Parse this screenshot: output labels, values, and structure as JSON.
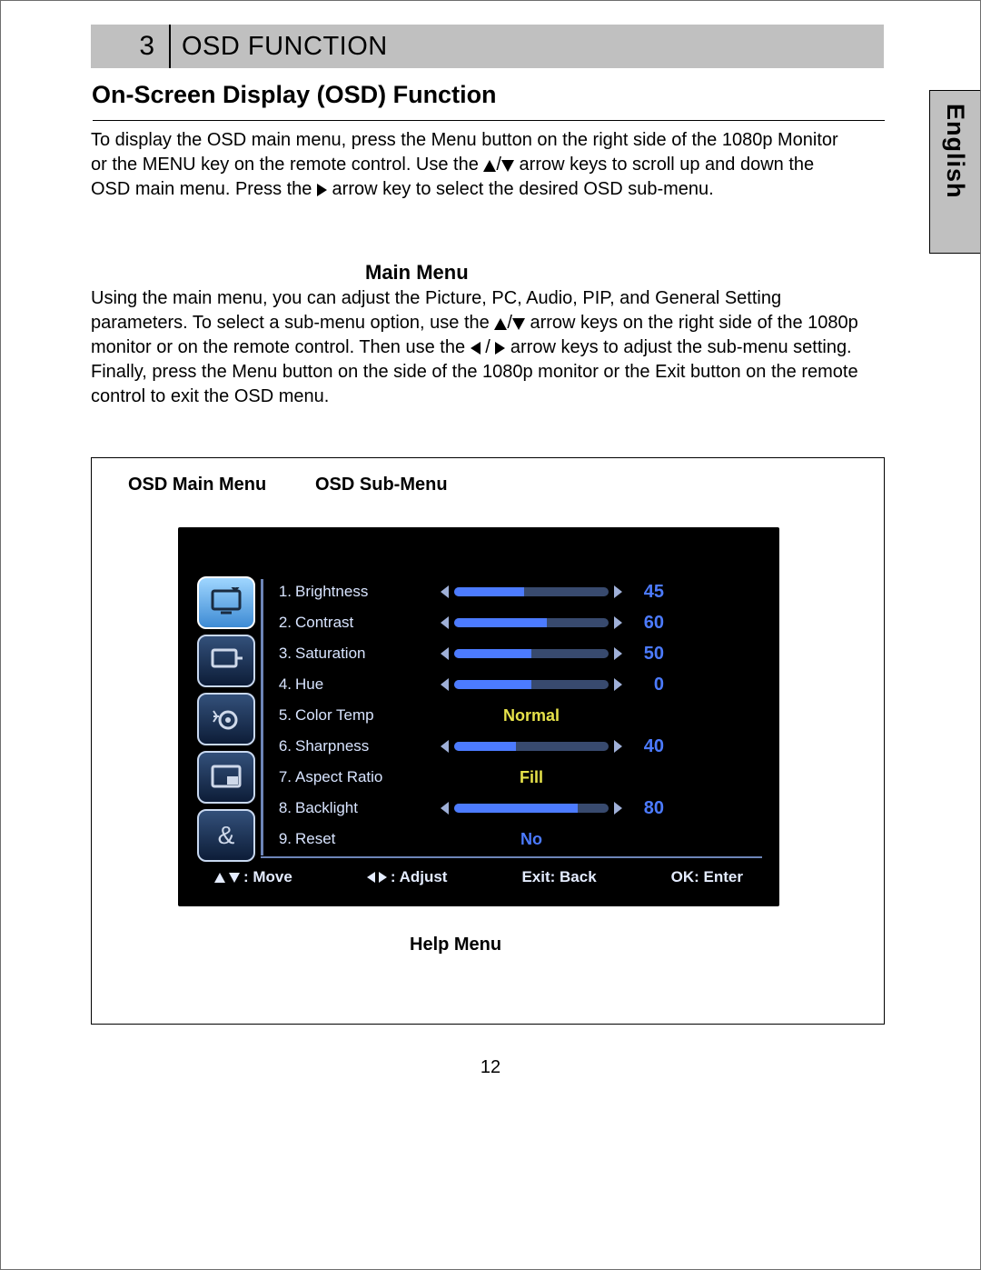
{
  "chapter": {
    "number": "3",
    "title": "OSD FUNCTION"
  },
  "language_tab": "English",
  "section_heading": "On-Screen Display (OSD) Function",
  "intro": {
    "p1": "To display the OSD main menu, press the Menu button on the right side of the 1080p Monitor or the MENU key on the remote control. Use the ",
    "p2": " arrow keys to scroll up and down the OSD main menu.    Press the ",
    "p3": " arrow key to select the desired OSD sub-menu."
  },
  "mainmenu": {
    "title": "Main Menu",
    "p1": "Using the main menu, you can adjust the Picture, PC, Audio, PIP, and General Setting parameters. To select a sub-menu option, use the ",
    "p2": "arrow keys on the right side of the 1080p monitor or on the remote control.    Then use the ",
    "p3": " arrow keys to adjust the sub-menu setting.    Finally, press the Menu button on the side of the 1080p monitor or the Exit button on the remote control to exit the OSD menu."
  },
  "figure": {
    "labels": {
      "main": "OSD Main Menu",
      "sub": "OSD Sub-Menu",
      "help": "Help Menu"
    },
    "main_menu_icons": [
      {
        "name": "picture-icon",
        "selected": true
      },
      {
        "name": "pc-icon",
        "selected": false
      },
      {
        "name": "audio-icon",
        "selected": false
      },
      {
        "name": "pip-icon",
        "selected": false
      },
      {
        "name": "ampersand-icon",
        "selected": false
      }
    ],
    "sub_menu": [
      {
        "n": "1.",
        "label": "Brightness",
        "type": "slider",
        "value": "45",
        "pct": 45
      },
      {
        "n": "2.",
        "label": "Contrast",
        "type": "slider",
        "value": "60",
        "pct": 60
      },
      {
        "n": "3.",
        "label": "Saturation",
        "type": "slider",
        "value": "50",
        "pct": 50
      },
      {
        "n": "4.",
        "label": "Hue",
        "type": "slider",
        "value": "0",
        "pct": 50
      },
      {
        "n": "5.",
        "label": "Color Temp",
        "type": "text",
        "value": "Normal",
        "color": "yellow"
      },
      {
        "n": "6.",
        "label": "Sharpness",
        "type": "slider",
        "value": "40",
        "pct": 40
      },
      {
        "n": "7.",
        "label": "Aspect Ratio",
        "type": "text",
        "value": "Fill",
        "color": "yellow"
      },
      {
        "n": "8.",
        "label": "Backlight",
        "type": "slider",
        "value": "80",
        "pct": 80
      },
      {
        "n": "9.",
        "label": "Reset",
        "type": "text",
        "value": "No",
        "color": "blue"
      }
    ],
    "help_bar": {
      "move": ": Move",
      "adjust": ": Adjust",
      "exit": "Exit: Back",
      "ok": "OK: Enter"
    }
  },
  "page_number": "12"
}
